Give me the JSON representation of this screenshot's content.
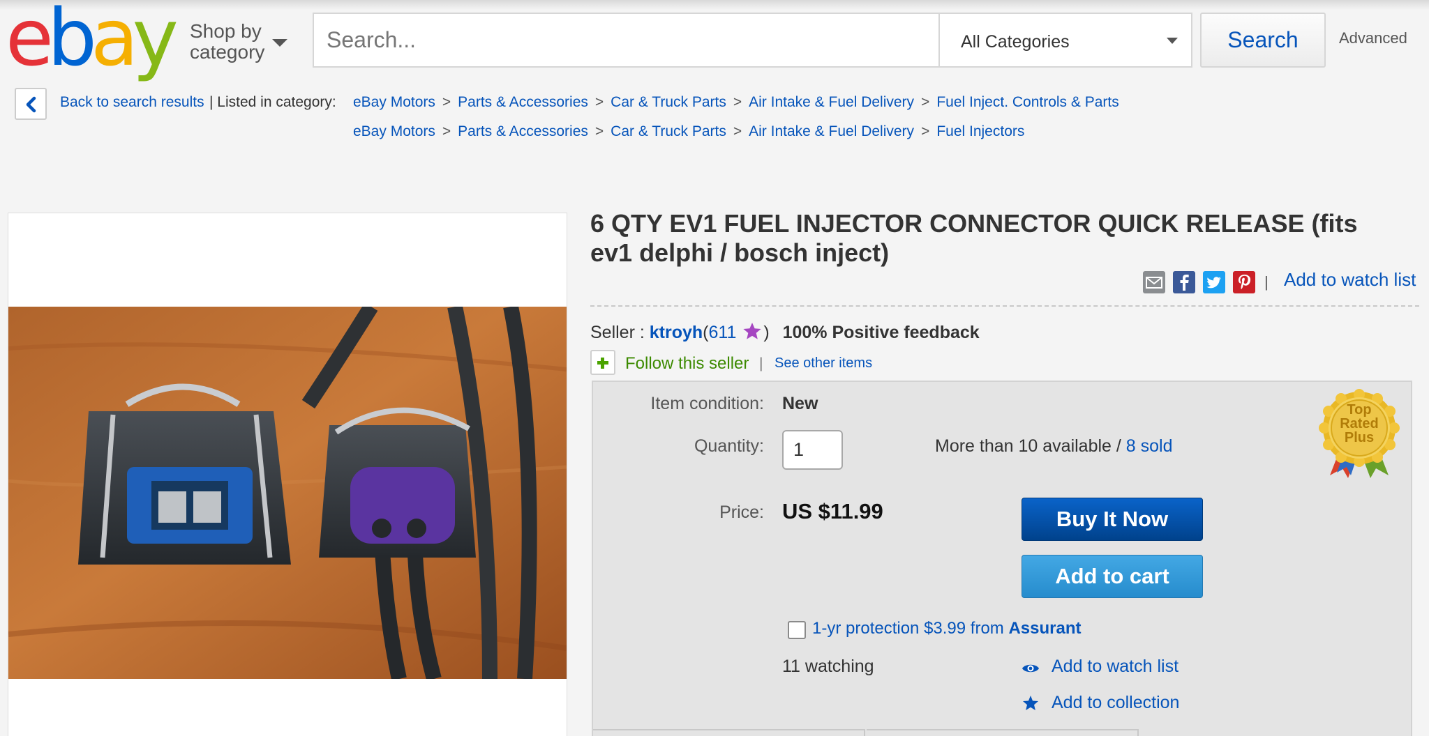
{
  "header": {
    "logo": [
      "e",
      "b",
      "a",
      "y"
    ],
    "shop_by": [
      "Shop by",
      "category"
    ],
    "search_placeholder": "Search...",
    "category": "All Categories",
    "search_button": "Search",
    "advanced": "Advanced"
  },
  "nav": {
    "back": "Back to search results",
    "listed_in": "|  Listed in category:",
    "breadcrumbs": [
      [
        "eBay Motors",
        "Parts & Accessories",
        "Car & Truck Parts",
        "Air Intake & Fuel Delivery",
        "Fuel Inject. Controls & Parts"
      ],
      [
        "eBay Motors",
        "Parts & Accessories",
        "Car & Truck Parts",
        "Air Intake & Fuel Delivery",
        "Fuel Injectors"
      ]
    ],
    "separator": ">"
  },
  "item": {
    "title": "6 QTY EV1 FUEL INJECTOR CONNECTOR QUICK RELEASE (fits ev1 delphi / bosch inject)",
    "share_icons": [
      "email-icon",
      "facebook-icon",
      "twitter-icon",
      "pinterest-icon"
    ],
    "add_watch_top": "Add to watch list",
    "seller_label": "Seller :",
    "seller_name": "ktroyh",
    "feedback_score": "611",
    "positive": "100% Positive feedback",
    "follow": "Follow this seller",
    "see_other": "See other items",
    "condition_label": "Item condition:",
    "condition": "New",
    "quantity_label": "Quantity:",
    "quantity": "1",
    "availability": "More than 10 available /",
    "sold": "8 sold",
    "price_label": "Price:",
    "price": "US $11.99",
    "buy_now": "Buy It Now",
    "add_cart": "Add to cart",
    "protection": "1-yr protection $3.99 from",
    "protection_vendor": "Assurant",
    "watching": "11 watching",
    "add_watch": "Add to watch list",
    "add_collection": "Add to collection",
    "badge": [
      "Top",
      "Rated",
      "Plus"
    ]
  },
  "colors": {
    "link": "#0654ba",
    "buy_now": "#0a63c9",
    "add_cart": "#2b8fd1",
    "follow": "#3c8a00",
    "star": "#a546c1"
  }
}
